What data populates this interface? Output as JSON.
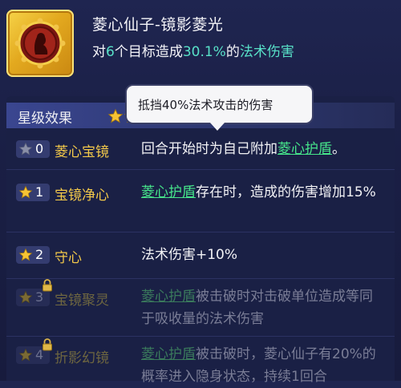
{
  "skill": {
    "title": "菱心仙子-镜影菱光",
    "desc_prefix": "对",
    "target_count": "6",
    "desc_mid": "个目标造成",
    "damage_pct": "30.1%",
    "desc_mid2": "的",
    "damage_type": "法术伤害",
    "icon": "crest-portrait-icon",
    "icon_color": "#e3a91f"
  },
  "star_effects": {
    "header": "星级效果",
    "tooltip": "抵挡40%法术攻击的伤害",
    "rows": [
      {
        "star_level": "0",
        "name": "菱心宝镜",
        "text_before": "回合开始时为自己附加",
        "keyword": "菱心护盾",
        "text_after": "。",
        "locked": false
      },
      {
        "star_level": "1",
        "name": "宝镜净心",
        "keyword": "菱心护盾",
        "text_after": "存在时，造成的伤害增加15%",
        "locked": false
      },
      {
        "star_level": "2",
        "name": "守心",
        "text_after": "法术伤害+10%",
        "locked": false
      },
      {
        "star_level": "3",
        "name": "宝镜聚灵",
        "keyword": "菱心护盾",
        "text_after": "被击破时对击破单位造成等同于吸收量的法术伤害",
        "locked": true
      },
      {
        "star_level": "4",
        "name": "折影幻镜",
        "keyword": "菱心护盾",
        "text_after": "被击破时，菱心仙子有20%的概率进入隐身状态，持续1回合",
        "locked": true
      }
    ]
  },
  "colors": {
    "highlight": "#58e1c8",
    "keyword": "#46e48a",
    "effect_name": "#f2c84a",
    "star": "#f6c334"
  }
}
